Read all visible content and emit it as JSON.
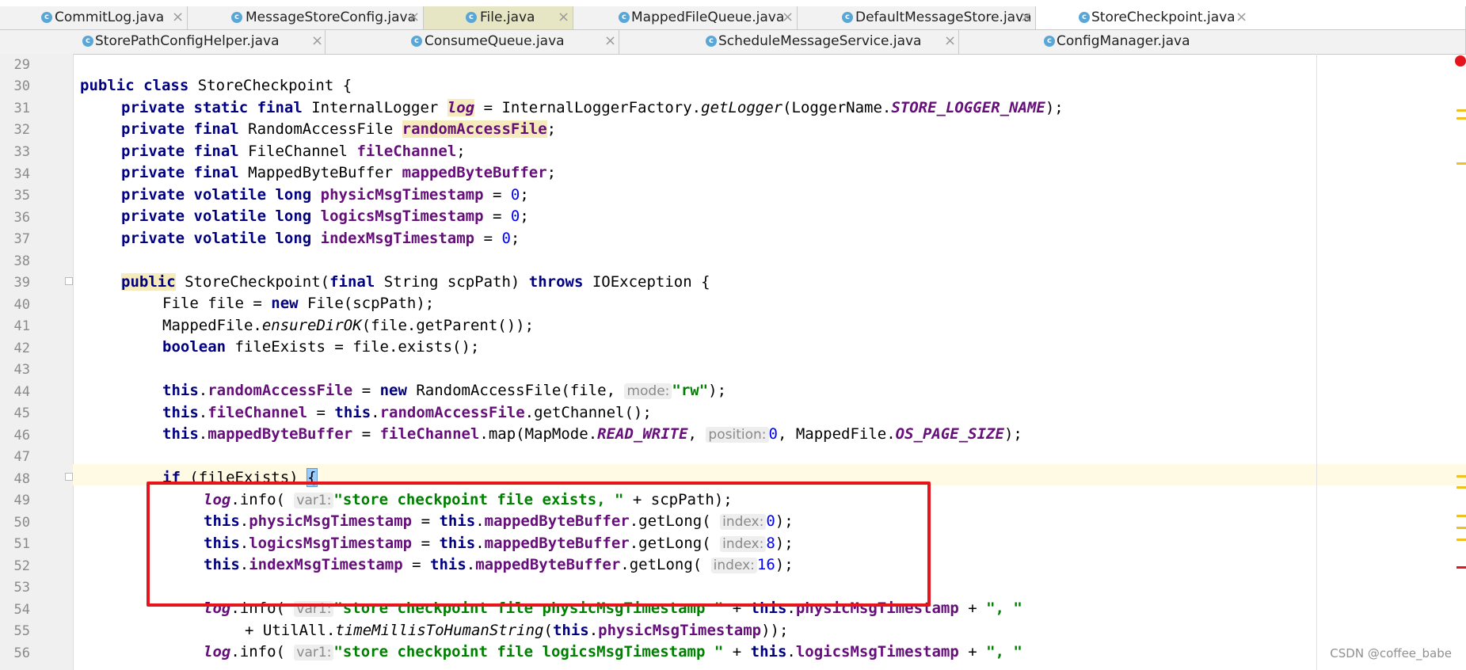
{
  "tabs_row1": [
    {
      "label": "CommitLog.java",
      "icon": "class-icon"
    },
    {
      "label": "MessageStoreConfig.java",
      "icon": "class-icon"
    },
    {
      "label": "File.java",
      "icon": "class-icon"
    },
    {
      "label": "MappedFileQueue.java",
      "icon": "class-icon"
    },
    {
      "label": "DefaultMessageStore.java",
      "icon": "class-icon"
    },
    {
      "label": "StoreCheckpoint.java",
      "icon": "class-icon",
      "active": true
    }
  ],
  "tabs_row2": [
    {
      "label": "StorePathConfigHelper.java",
      "icon": "class-icon"
    },
    {
      "label": "ConsumeQueue.java",
      "icon": "class-icon"
    },
    {
      "label": "ScheduleMessageService.java",
      "icon": "class-icon"
    },
    {
      "label": "ConfigManager.java",
      "icon": "class-icon"
    }
  ],
  "tab_close_glyph": "×",
  "tab_icon_letter": "c",
  "line_numbers": [
    "29",
    "30",
    "31",
    "32",
    "33",
    "34",
    "35",
    "36",
    "37",
    "38",
    "39",
    "40",
    "41",
    "42",
    "43",
    "44",
    "45",
    "46",
    "47",
    "48",
    "49",
    "50",
    "51",
    "52",
    "53",
    "54",
    "55",
    "56"
  ],
  "code": {
    "l30": {
      "kw1": "public class",
      "name": " StoreCheckpoint {"
    },
    "l31": {
      "kw": "private static final",
      "t1": " InternalLogger ",
      "fld": "log",
      "t2": " = InternalLoggerFactory.",
      "m": "getLogger",
      "t3": "(LoggerName.",
      "sfld": "STORE_LOGGER_NAME",
      "t4": ");"
    },
    "l32": {
      "kw": "private final",
      "t1": " RandomAccessFile ",
      "fld": "randomAccessFile",
      "t2": ";"
    },
    "l33": {
      "kw": "private final",
      "t1": " FileChannel ",
      "fld": "fileChannel",
      "t2": ";"
    },
    "l34": {
      "kw": "private final",
      "t1": " MappedByteBuffer ",
      "fld": "mappedByteBuffer",
      "t2": ";"
    },
    "l35": {
      "kw": "private volatile long",
      "fld": " physicMsgTimestamp",
      "t1": " = ",
      "num": "0",
      "t2": ";"
    },
    "l36": {
      "kw": "private volatile long",
      "fld": " logicsMsgTimestamp",
      "t1": " = ",
      "num": "0",
      "t2": ";"
    },
    "l37": {
      "kw": "private volatile long",
      "fld": " indexMsgTimestamp",
      "t1": " = ",
      "num": "0",
      "t2": ";"
    },
    "l39": {
      "kw1": "public",
      "t1": " StoreCheckpoint(",
      "kw2": "final",
      "t2": " String scpPath) ",
      "kw3": "throws",
      "t3": " IOException {"
    },
    "l40": {
      "t1": "File file = ",
      "kw": "new",
      "t2": " File(scpPath);"
    },
    "l41": {
      "t1": "MappedFile.",
      "m": "ensureDirOK",
      "t2": "(file.getParent());"
    },
    "l42": {
      "kw": "boolean",
      "t1": " fileExists = file.exists();"
    },
    "l44": {
      "kw": "this",
      "t1": ".",
      "fld": "randomAccessFile",
      "t2": " = ",
      "kw2": "new",
      "t3": " RandomAccessFile(file, ",
      "hint": "mode:",
      "str": "\"rw\"",
      "t4": ");"
    },
    "l45": {
      "kw": "this",
      "t1": ".",
      "fld": "fileChannel",
      "t2": " = ",
      "kw2": "this",
      "t3": ".",
      "fld2": "randomAccessFile",
      "t4": ".getChannel();"
    },
    "l46": {
      "kw": "this",
      "t1": ".",
      "fld": "mappedByteBuffer",
      "t2": " = ",
      "fld2": "fileChannel",
      "t3": ".map(MapMode.",
      "sfld": "READ_WRITE",
      "t4": ", ",
      "hint": "position:",
      "num": "0",
      "t5": ", MappedFile.",
      "sfld2": "OS_PAGE_SIZE",
      "t6": ");"
    },
    "l48": {
      "kw": "if",
      "t1": " (fileExists) ",
      "brace": "{"
    },
    "l49": {
      "fld": "log",
      "t1": ".info( ",
      "hint": "var1:",
      "str": "\"store checkpoint file exists, \"",
      "t2": " + scpPath);"
    },
    "l50": {
      "kw": "this",
      "t1": ".",
      "fld": "physicMsgTimestamp",
      "t2": " = ",
      "kw2": "this",
      "t3": ".",
      "fld2": "mappedByteBuffer",
      "t4": ".getLong( ",
      "hint": "index:",
      "num": "0",
      "t5": ");"
    },
    "l51": {
      "kw": "this",
      "t1": ".",
      "fld": "logicsMsgTimestamp",
      "t2": " = ",
      "kw2": "this",
      "t3": ".",
      "fld2": "mappedByteBuffer",
      "t4": ".getLong( ",
      "hint": "index:",
      "num": "8",
      "t5": ");"
    },
    "l52": {
      "kw": "this",
      "t1": ".",
      "fld": "indexMsgTimestamp",
      "t2": " = ",
      "kw2": "this",
      "t3": ".",
      "fld2": "mappedByteBuffer",
      "t4": ".getLong( ",
      "hint": "index:",
      "num": "16",
      "t5": ");"
    },
    "l54": {
      "fld": "log",
      "t1": ".info( ",
      "hint": "var1:",
      "str": "\"store checkpoint file physicMsgTimestamp \"",
      "t2": " + ",
      "kw": "this",
      "t3": ".",
      "fld2": "physicMsgTimestamp",
      "t4": " + ",
      "str2": "\", \""
    },
    "l55": {
      "t1": "+ UtilAll.",
      "m": "timeMillisToHumanString",
      "t2": "(",
      "kw": "this",
      "t3": ".",
      "fld": "physicMsgTimestamp",
      "t4": "));"
    },
    "l56": {
      "fld": "log",
      "t1": ".info( ",
      "hint": "var1:",
      "str": "\"store checkpoint file logicsMsgTimestamp \"",
      "t2": " + ",
      "kw": "this",
      "t3": ".",
      "fld2": "logicsMsgTimestamp",
      "t4": " + ",
      "str2": "\", \""
    }
  },
  "watermark": "CSDN @coffee_babe",
  "colors": {
    "keyword": "#000080",
    "field": "#660e7a",
    "string": "#008000",
    "number": "#0000ff",
    "annotation_box": "#e8141c"
  }
}
